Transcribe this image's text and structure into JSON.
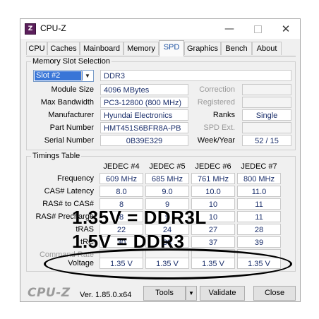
{
  "window": {
    "title": "CPU-Z",
    "icon": "cpuz-app-icon",
    "controls": {
      "minimize": "—",
      "close": "✕"
    }
  },
  "tabs": [
    "CPU",
    "Caches",
    "Mainboard",
    "Memory",
    "SPD",
    "Graphics",
    "Bench",
    "About"
  ],
  "active_tab": "SPD",
  "memory_slot": {
    "group_label": "Memory Slot Selection",
    "selected_slot": "Slot #2",
    "type": "DDR3",
    "labels": {
      "module_size": "Module Size",
      "max_bandwidth": "Max Bandwidth",
      "manufacturer": "Manufacturer",
      "part_number": "Part Number",
      "serial_number": "Serial Number",
      "correction": "Correction",
      "registered": "Registered",
      "ranks": "Ranks",
      "spd_ext": "SPD Ext.",
      "week_year": "Week/Year"
    },
    "values": {
      "module_size": "4096 MBytes",
      "max_bandwidth": "PC3-12800 (800 MHz)",
      "manufacturer": "Hyundai Electronics",
      "part_number": "HMT451S6BFR8A-PB",
      "serial_number": "0B39E329",
      "ranks": "Single",
      "week_year": "52 / 15"
    }
  },
  "timings": {
    "group_label": "Timings Table",
    "columns": [
      "JEDEC #4",
      "JEDEC #5",
      "JEDEC #6",
      "JEDEC #7"
    ],
    "rows": {
      "frequency": {
        "label": "Frequency",
        "values": [
          "609 MHz",
          "685 MHz",
          "761 MHz",
          "800 MHz"
        ]
      },
      "cas": {
        "label": "CAS# Latency",
        "values": [
          "8.0",
          "9.0",
          "10.0",
          "11.0"
        ]
      },
      "ras_cas": {
        "label": "RAS# to CAS#",
        "values": [
          "8",
          "9",
          "10",
          "11"
        ]
      },
      "ras_pre": {
        "label": "RAS# Precharge",
        "values": [
          "8",
          "9",
          "10",
          "11"
        ]
      },
      "tras": {
        "label": "tRAS",
        "values": [
          "22",
          "24",
          "27",
          "28"
        ]
      },
      "trc": {
        "label": "tRC",
        "values": [
          "30",
          "33",
          "37",
          "39"
        ]
      },
      "command_rate": {
        "label": "Command Rate"
      },
      "voltage": {
        "label": "Voltage",
        "values": [
          "1.35 V",
          "1.35 V",
          "1.35 V",
          "1.35 V"
        ]
      }
    }
  },
  "annotation": {
    "line1": "1.35V = DDR3L",
    "line2": "1.5V = DDR3",
    "color": "#000000"
  },
  "footer": {
    "logo": "CPU-Z",
    "version": "Ver. 1.85.0.x64",
    "tools_label": "Tools",
    "validate_label": "Validate",
    "close_label": "Close"
  },
  "colors": {
    "value_text": "#1b2f6b",
    "active_tab_text": "#1a4fa0",
    "selection": "#3875d7"
  }
}
